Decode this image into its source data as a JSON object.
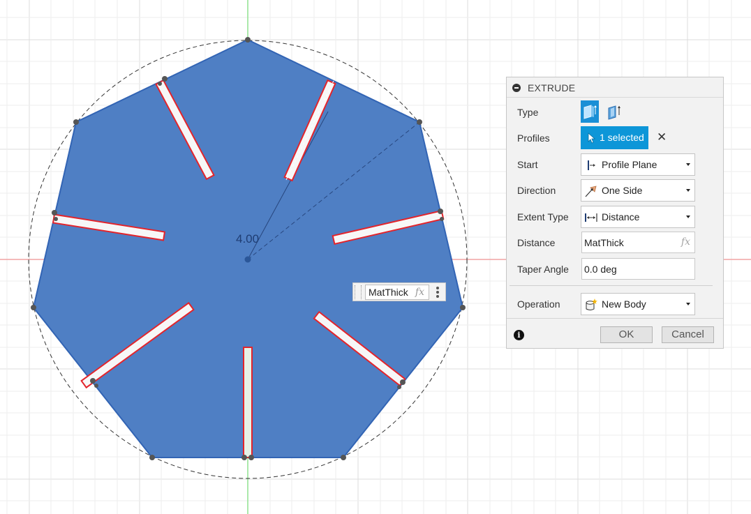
{
  "sketch": {
    "dimension_label": "4.00",
    "inline_input_value": "MatThick",
    "inline_fx_label": "fx"
  },
  "dialog": {
    "title": "EXTRUDE",
    "rows": {
      "type": {
        "label": "Type"
      },
      "profiles": {
        "label": "Profiles",
        "value": "1 selected"
      },
      "start": {
        "label": "Start",
        "value": "Profile Plane"
      },
      "direction": {
        "label": "Direction",
        "value": "One Side"
      },
      "extent_type": {
        "label": "Extent Type",
        "value": "Distance"
      },
      "distance": {
        "label": "Distance",
        "value": "MatThick",
        "fx": "fx"
      },
      "taper_angle": {
        "label": "Taper Angle",
        "value": "0.0 deg"
      },
      "operation": {
        "label": "Operation",
        "value": "New Body"
      }
    },
    "ok_label": "OK",
    "cancel_label": "Cancel"
  },
  "colors": {
    "profile_fill": "#4f7fc4",
    "profile_stroke": "#3264b4",
    "slot_outline": "#e3242b",
    "accent": "#0d96d8",
    "grid": "#dcdcdc",
    "axis_y": "#8fe28f",
    "axis_x": "#f2a3a3"
  }
}
